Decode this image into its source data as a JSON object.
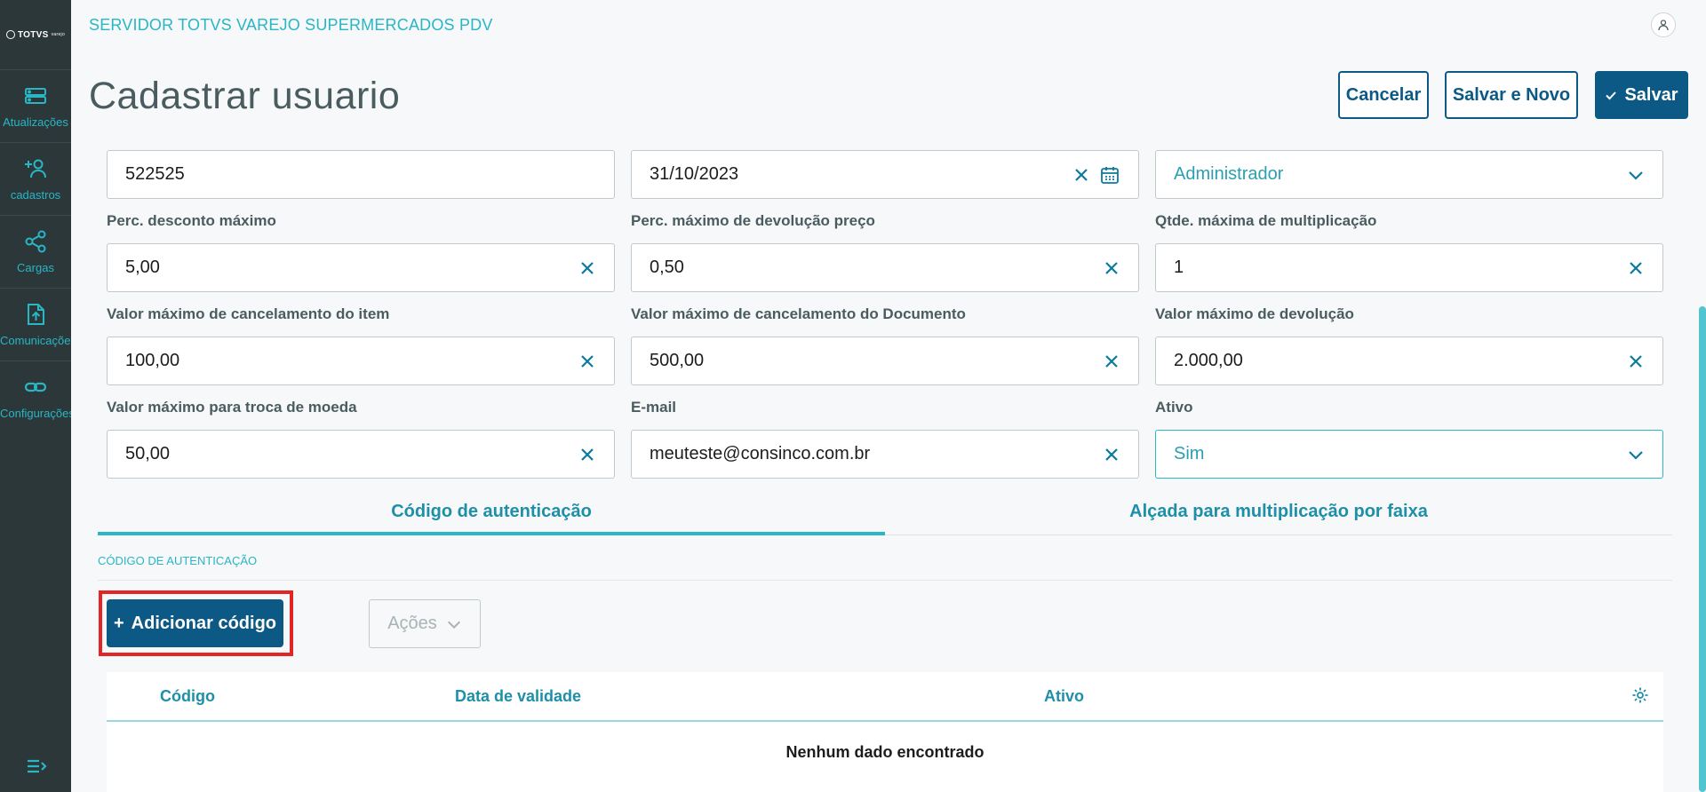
{
  "app": {
    "title": "SERVIDOR TOTVS VAREJO SUPERMERCADOS PDV",
    "logo_text": "TOTVS",
    "logo_sub": "varejo"
  },
  "sidebar": {
    "items": [
      {
        "label": "Atualizações",
        "icon": "server-icon"
      },
      {
        "label": "cadastros",
        "icon": "add-user-icon"
      },
      {
        "label": "Cargas",
        "icon": "share-icon"
      },
      {
        "label": "Comunicações",
        "icon": "upload-file-icon"
      },
      {
        "label": "Configurações",
        "icon": "link-icon"
      }
    ]
  },
  "page": {
    "title": "Cadastrar usuario"
  },
  "toolbar": {
    "cancel_label": "Cancelar",
    "save_new_label": "Salvar e Novo",
    "save_label": "Salvar"
  },
  "form": {
    "code": {
      "value": "522525"
    },
    "date": {
      "value": "31/10/2023"
    },
    "profile": {
      "value": "Administrador"
    },
    "desconto": {
      "label": "Perc. desconto máximo",
      "value": "5,00"
    },
    "devolucao_preco": {
      "label": "Perc. máximo de devolução preço",
      "value": "0,50"
    },
    "multiplicacao": {
      "label": "Qtde. máxima de multiplicação",
      "value": "1"
    },
    "cancel_item": {
      "label": "Valor máximo de cancelamento do item",
      "value": "100,00"
    },
    "cancel_doc": {
      "label": "Valor máximo de cancelamento do Documento",
      "value": "500,00"
    },
    "devolucao": {
      "label": "Valor máximo de devolução",
      "value": "2.000,00"
    },
    "troca_moeda": {
      "label": "Valor máximo para troca de moeda",
      "value": "50,00"
    },
    "email": {
      "label": "E-mail",
      "value": "meuteste@consinco.com.br"
    },
    "ativo": {
      "label": "Ativo",
      "value": "Sim"
    }
  },
  "tabs": [
    {
      "label": "Código de autenticação",
      "active": true
    },
    {
      "label": "Alçada para multiplicação por faixa",
      "active": false
    }
  ],
  "section": {
    "title": "CÓDIGO DE AUTENTICAÇÃO",
    "add_label": "Adicionar código",
    "actions_label": "Ações"
  },
  "table": {
    "columns": [
      "Código",
      "Data de validade",
      "Ativo"
    ],
    "empty_text": "Nenhum dado encontrado"
  },
  "colors": {
    "sidebar_bg": "#2c3739",
    "accent": "#29b6c5",
    "primary": "#0c5985",
    "highlight": "#e32526"
  }
}
